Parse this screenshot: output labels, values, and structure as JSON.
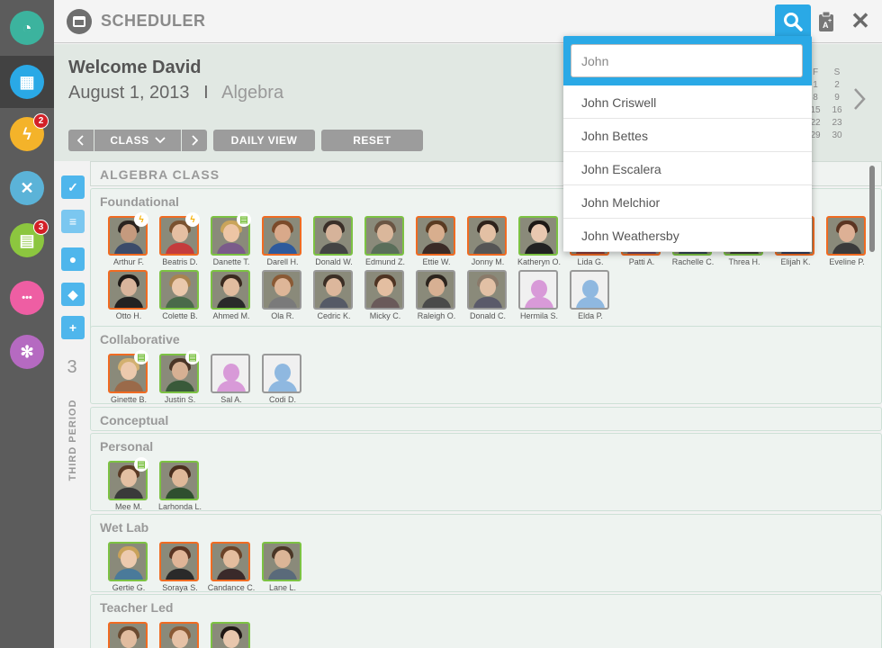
{
  "rail": {
    "items": [
      {
        "icon": "gauge-icon",
        "color": "#3cb39e",
        "badge": ""
      },
      {
        "icon": "calendar-icon",
        "color": "#2aa9e6",
        "badge": "",
        "active": true
      },
      {
        "icon": "lightning-icon",
        "color": "#f4b32a",
        "badge": "2"
      },
      {
        "icon": "tools-icon",
        "color": "#5bb3d8",
        "badge": ""
      },
      {
        "icon": "clipboard-icon",
        "color": "#8cc63f",
        "badge": "3"
      },
      {
        "icon": "chat-icon",
        "color": "#ee5ea3",
        "badge": ""
      },
      {
        "icon": "gear-icon",
        "color": "#b56ac1",
        "badge": ""
      }
    ]
  },
  "topbar": {
    "title": "SCHEDULER",
    "close_symbol": "✕"
  },
  "header": {
    "welcome": "Welcome David",
    "date": "August 1, 2013",
    "separator": "I",
    "subject": "Algebra",
    "controls": {
      "class_label": "CLASS",
      "daily_label": "DAILY VIEW",
      "reset_label": "RESET"
    }
  },
  "mini_calendar": {
    "headers": [
      "F",
      "S"
    ],
    "rows": [
      [
        "1",
        "2"
      ],
      [
        "8",
        "9"
      ],
      [
        "15",
        "16"
      ],
      [
        "22",
        "23"
      ],
      [
        "29",
        "30"
      ]
    ]
  },
  "period": {
    "number": "3",
    "label": "THIRD PERIOD"
  },
  "class_title": "ALGEBRA CLASS",
  "groups": [
    {
      "name": "Foundational",
      "students": [
        {
          "name": "Arthur F.",
          "border": "orange",
          "mark": "bolt",
          "skin": "#c59a7e",
          "hair": "#2b2420",
          "shirt": "#3b4b6a"
        },
        {
          "name": "Beatris D.",
          "border": "orange",
          "mark": "bolt",
          "skin": "#e5bfa2",
          "hair": "#7a5230",
          "shirt": "#c43c3c"
        },
        {
          "name": "Danette T.",
          "border": "green",
          "mark": "clip",
          "skin": "#edc5a5",
          "hair": "#c9a45a",
          "shirt": "#7b5b8a"
        },
        {
          "name": "Darell H.",
          "border": "orange",
          "mark": "",
          "skin": "#d9a98a",
          "hair": "#7b4a2a",
          "shirt": "#2e5a9c"
        },
        {
          "name": "Donald W.",
          "border": "green",
          "mark": "",
          "skin": "#d6b39a",
          "hair": "#3a2f28",
          "shirt": "#444444"
        },
        {
          "name": "Edmund Z.",
          "border": "green",
          "mark": "",
          "skin": "#dab79b",
          "hair": "#6a5543",
          "shirt": "#5a6e5a"
        },
        {
          "name": "Ettie W.",
          "border": "orange",
          "mark": "",
          "skin": "#d8ae8e",
          "hair": "#5a3b22",
          "shirt": "#3b2b26"
        },
        {
          "name": "Jonny M.",
          "border": "orange",
          "mark": "",
          "skin": "#e3c0a4",
          "hair": "#2e221b",
          "shirt": "#555555"
        },
        {
          "name": "Katheryn O.",
          "border": "green",
          "mark": "",
          "skin": "#e9c8b0",
          "hair": "#1d1815",
          "shirt": "#222222"
        },
        {
          "name": "Lida G.",
          "border": "orange",
          "mark": "",
          "skin": "#e0b89c",
          "hair": "#6b4a2f",
          "shirt": "#8a3c3c"
        },
        {
          "name": "Patti A.",
          "border": "orange",
          "mark": "",
          "skin": "#e6c0a2",
          "hair": "#7a5535",
          "shirt": "#6a4a6a"
        },
        {
          "name": "Rachelle C.",
          "border": "green",
          "mark": "",
          "skin": "#e8c6ac",
          "hair": "#4a3020",
          "shirt": "#334455"
        },
        {
          "name": "Threa H.",
          "border": "green",
          "mark": "",
          "skin": "#dbb497",
          "hair": "#33261d",
          "shirt": "#3a3a3a"
        },
        {
          "name": "Elijah K.",
          "border": "orange",
          "mark": "",
          "skin": "#cfa184",
          "hair": "#2c211b",
          "shirt": "#2f3f5f"
        },
        {
          "name": "Eveline P.",
          "border": "orange",
          "mark": "",
          "skin": "#ddb095",
          "hair": "#5b3522",
          "shirt": "#3b3b3b"
        },
        {
          "name": "Otto H.",
          "border": "orange",
          "mark": "",
          "skin": "#d9b59c",
          "hair": "#1f1a17",
          "shirt": "#222222"
        },
        {
          "name": "Colette B.",
          "border": "green",
          "mark": "",
          "skin": "#eac8ac",
          "hair": "#a88350",
          "shirt": "#4a6a4a"
        },
        {
          "name": "Ahmed M.",
          "border": "green",
          "mark": "",
          "skin": "#e1bc9f",
          "hair": "#3a2a1f",
          "shirt": "#2a2a2a"
        },
        {
          "name": "Ola R.",
          "border": "gray",
          "mark": "",
          "skin": "#deb698",
          "hair": "#8a5a35",
          "shirt": "#7a7a7a"
        },
        {
          "name": "Cedric K.",
          "border": "gray",
          "mark": "",
          "skin": "#dcb79c",
          "hair": "#3b2e25",
          "shirt": "#555a66"
        },
        {
          "name": "Micky C.",
          "border": "gray",
          "mark": "",
          "skin": "#e3bea1",
          "hair": "#4f3423",
          "shirt": "#6a5a5a"
        },
        {
          "name": "Raleigh O.",
          "border": "gray",
          "mark": "",
          "skin": "#d7b093",
          "hair": "#2c241e",
          "shirt": "#4a4a4a"
        },
        {
          "name": "Donald C.",
          "border": "gray",
          "mark": "",
          "skin": "#e2c0a5",
          "hair": "#8a7a6a",
          "shirt": "#5a5a6a"
        },
        {
          "name": "Hermila S.",
          "border": "gray",
          "mark": "",
          "placeholder": "#d89ad8"
        },
        {
          "name": "Elda P.",
          "border": "gray",
          "mark": "",
          "placeholder": "#8fb8e0"
        }
      ]
    },
    {
      "name": "Collaborative",
      "students": [
        {
          "name": "Ginette B.",
          "border": "orange",
          "mark": "clip",
          "skin": "#ecc9ad",
          "hair": "#d2b070",
          "shirt": "#9a6a4a"
        },
        {
          "name": "Justin S.",
          "border": "green",
          "mark": "clip",
          "skin": "#d6b093",
          "hair": "#4a3526",
          "shirt": "#3a5a3a"
        },
        {
          "name": "Sal A.",
          "border": "gray",
          "mark": "",
          "placeholder": "#d89ad8"
        },
        {
          "name": "Codi D.",
          "border": "gray",
          "mark": "",
          "placeholder": "#8fb8e0"
        }
      ]
    },
    {
      "name": "Conceptual",
      "students": []
    },
    {
      "name": "Personal",
      "students": [
        {
          "name": "Mee M.",
          "border": "green",
          "mark": "clip",
          "skin": "#e4c0a3",
          "hair": "#5a3a25",
          "shirt": "#3a3a3a"
        },
        {
          "name": "Larhonda L.",
          "border": "green",
          "mark": "",
          "skin": "#dfb899",
          "hair": "#4a2e1e",
          "shirt": "#2f4f2f"
        }
      ]
    },
    {
      "name": "Wet Lab",
      "students": [
        {
          "name": "Gertie G.",
          "border": "green",
          "mark": "",
          "skin": "#edcaae",
          "hair": "#c9a25a",
          "shirt": "#4a7a9a"
        },
        {
          "name": "Soraya S.",
          "border": "orange",
          "mark": "",
          "skin": "#e0b597",
          "hair": "#5a3523",
          "shirt": "#2a2a2a"
        },
        {
          "name": "Candance C.",
          "border": "orange",
          "mark": "",
          "skin": "#e4bd9e",
          "hair": "#6b4328",
          "shirt": "#3a2a2a"
        },
        {
          "name": "Lane L.",
          "border": "green",
          "mark": "",
          "skin": "#dbb597",
          "hair": "#4a3626",
          "shirt": "#5a6a7a"
        }
      ]
    },
    {
      "name": "Teacher Led",
      "students": [
        {
          "name": "",
          "border": "orange",
          "mark": "",
          "skin": "#e1bc9f",
          "hair": "#6a4a30",
          "shirt": "#4a4a4a"
        },
        {
          "name": "",
          "border": "orange",
          "mark": "",
          "skin": "#e6c2a6",
          "hair": "#8a5a35",
          "shirt": "#6a3a3a"
        },
        {
          "name": "",
          "border": "green",
          "mark": "",
          "skin": "#e8c7ad",
          "hair": "#1f1815",
          "shirt": "#222222"
        }
      ]
    }
  ],
  "search": {
    "query": "John",
    "results": [
      "John Criswell",
      "John Bettes",
      "John Escalera",
      "John Melchior",
      "John Weathersby"
    ]
  },
  "colors": {
    "accent": "#2aa9e6",
    "orange": "#f06b22",
    "green": "#7cc243"
  }
}
